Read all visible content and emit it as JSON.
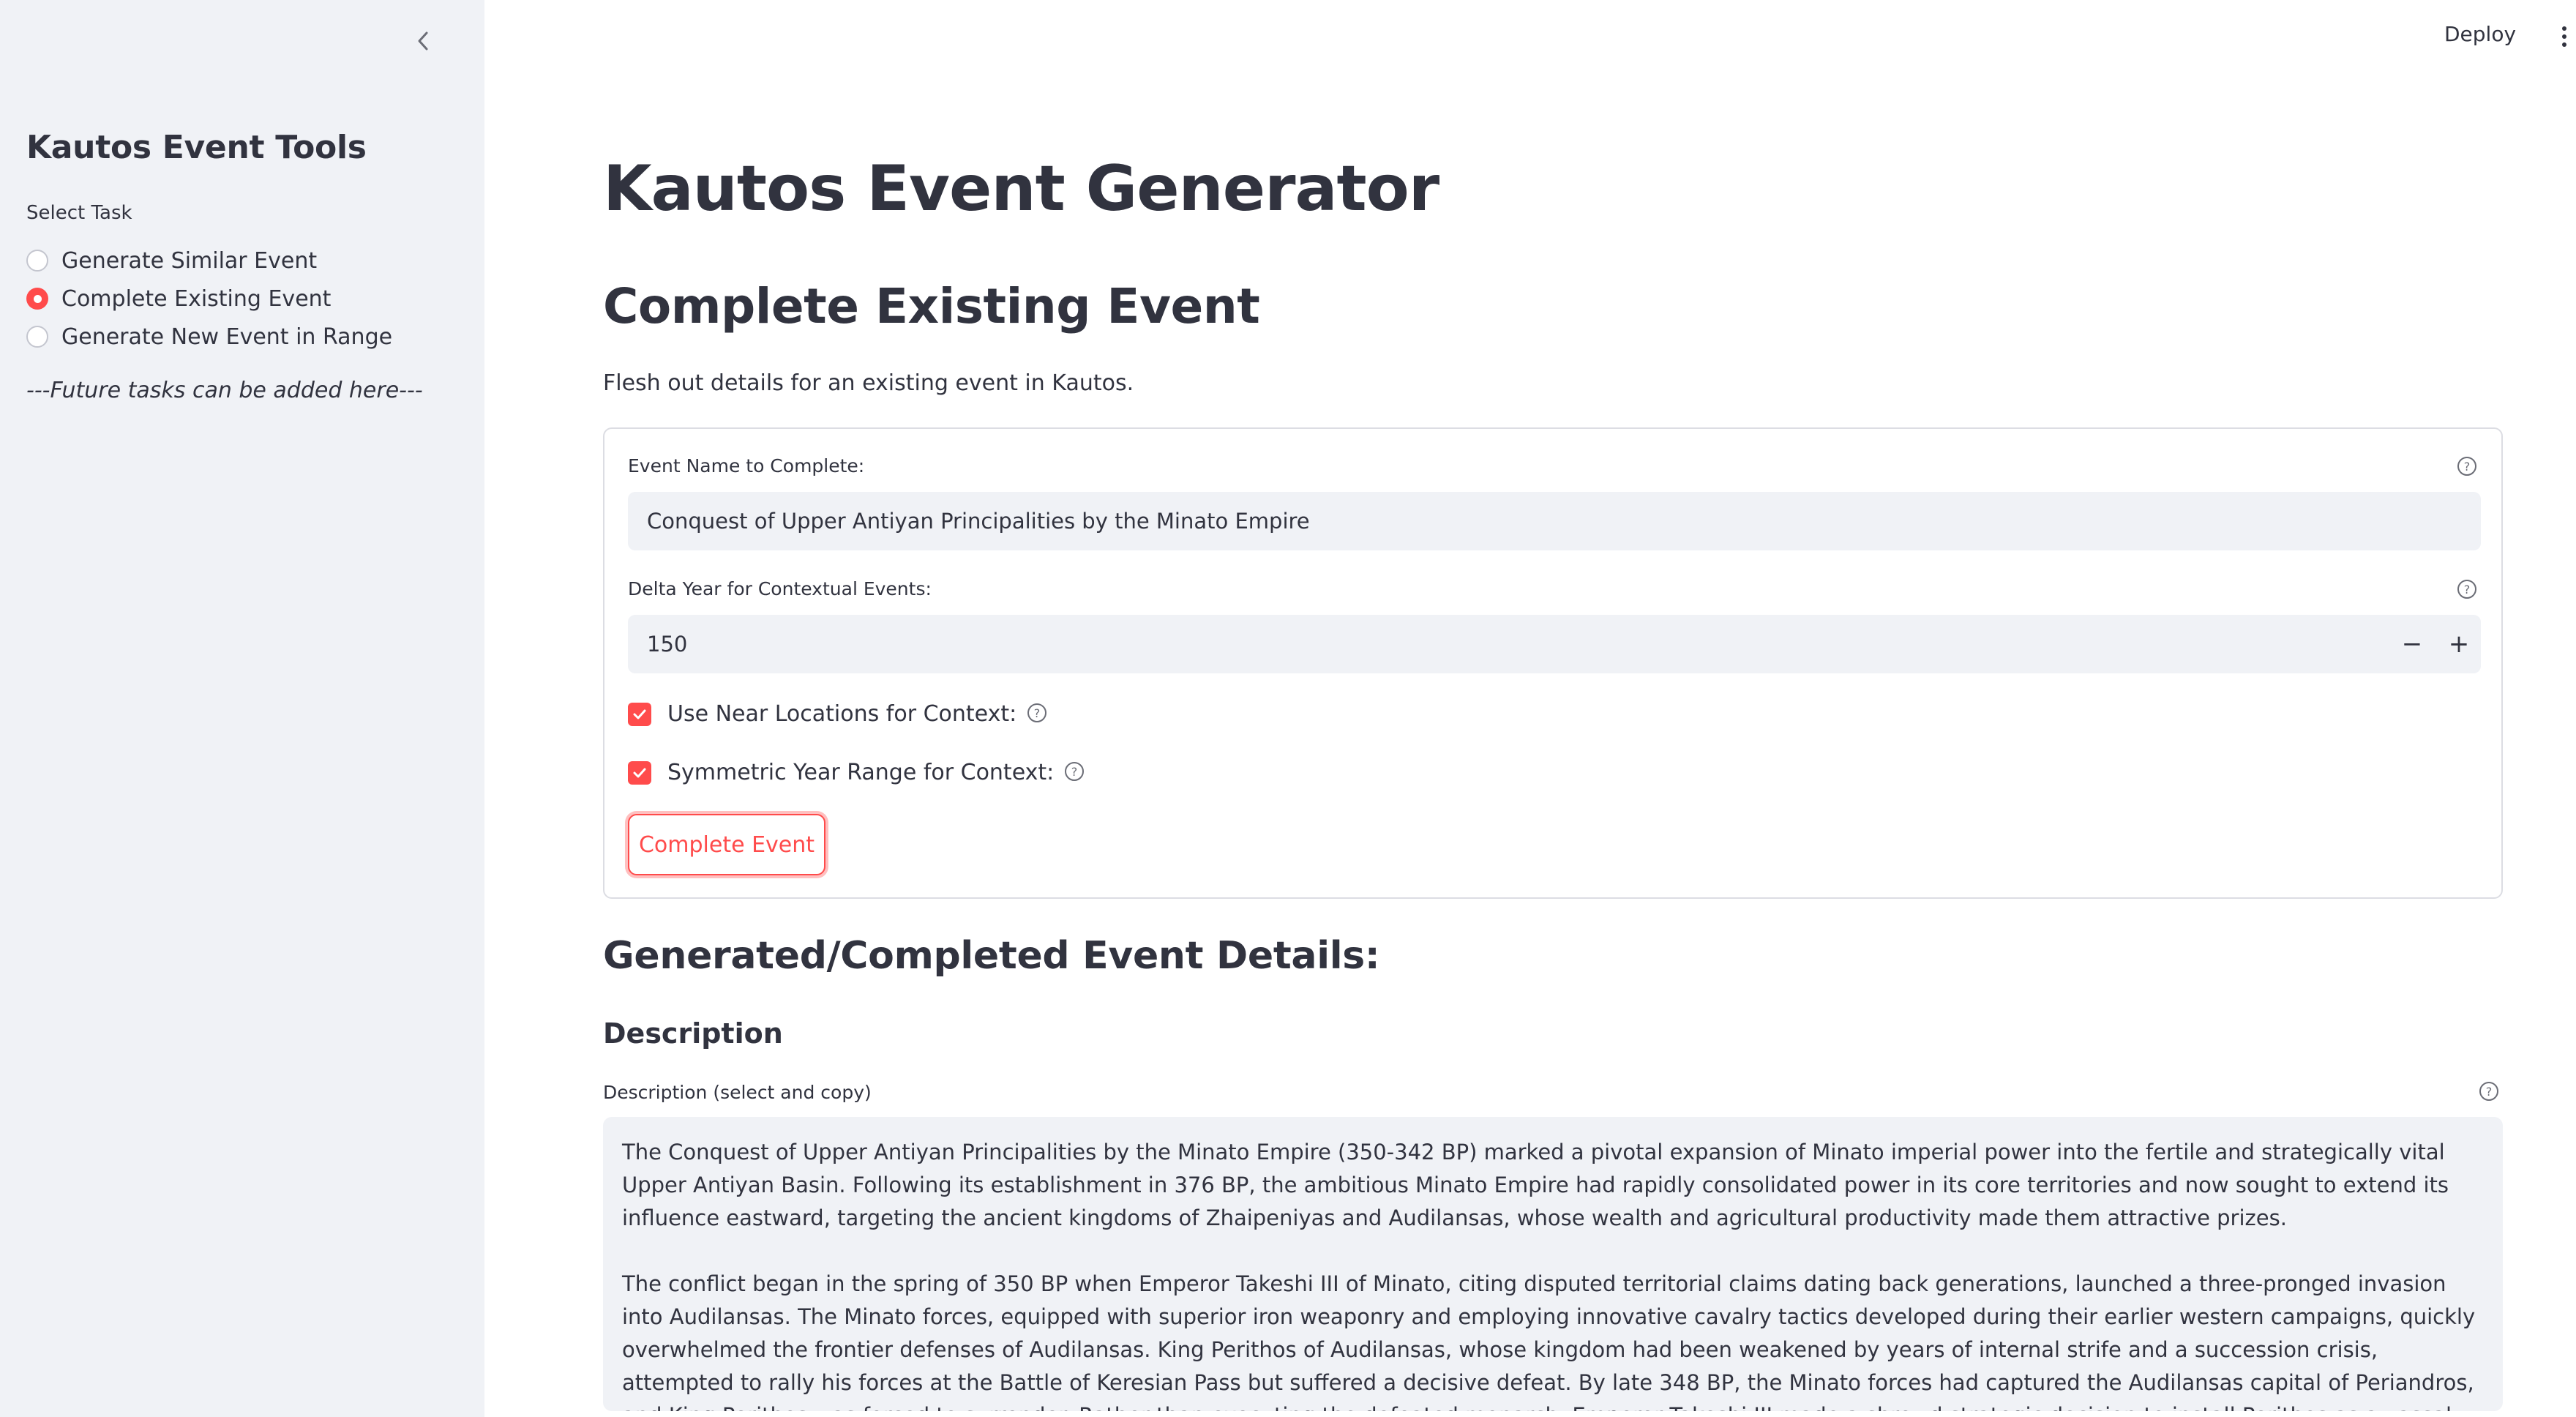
{
  "sidebar": {
    "title": "Kautos Event Tools",
    "select_label": "Select Task",
    "options": [
      {
        "label": "Generate Similar Event",
        "selected": false
      },
      {
        "label": "Complete Existing Event",
        "selected": true
      },
      {
        "label": "Generate New Event in Range",
        "selected": false
      }
    ],
    "note": "---Future tasks can be added here---"
  },
  "header": {
    "deploy_label": "Deploy"
  },
  "main": {
    "title": "Kautos Event Generator",
    "section_title": "Complete Existing Event",
    "section_desc": "Flesh out details for an existing event in Kautos.",
    "form": {
      "event_name_label": "Event Name to Complete:",
      "event_name_value": "Conquest of Upper Antiyan Principalities by the Minato Empire",
      "delta_year_label": "Delta Year for Contextual Events:",
      "delta_year_value": "150",
      "minus_label": "−",
      "plus_label": "+",
      "near_locations_label": "Use Near Locations for Context:",
      "near_locations_checked": true,
      "symmetric_label": "Symmetric Year Range for Context:",
      "symmetric_checked": true,
      "submit_label": "Complete Event"
    },
    "results_title": "Generated/Completed Event Details:",
    "description_heading": "Description",
    "description_label": "Description (select and copy)",
    "description_paragraphs": [
      "The Conquest of Upper Antiyan Principalities by the Minato Empire (350-342 BP) marked a pivotal expansion of Minato imperial power into the fertile and strategically vital Upper Antiyan Basin. Following its establishment in 376 BP, the ambitious Minato Empire had rapidly consolidated power in its core territories and now sought to extend its influence eastward, targeting the ancient kingdoms of Zhaipeniyas and Audilansas, whose wealth and agricultural productivity made them attractive prizes.",
      "The conflict began in the spring of 350 BP when Emperor Takeshi III of Minato, citing disputed territorial claims dating back generations, launched a three-pronged invasion into Audilansas. The Minato forces, equipped with superior iron weaponry and employing innovative cavalry tactics developed during their earlier western campaigns, quickly overwhelmed the frontier defenses of Audilansas. King Perithos of Audilansas, whose kingdom had been weakened by years of internal strife and a succession crisis, attempted to rally his forces at the Battle of Keresian Pass but suffered a decisive defeat. By late 348 BP, the Minato forces had captured the Audilansas capital of Periandros, and King Perithos was forced to surrender. Rather than executing the defeated monarch, Emperor Takeshi III made a shrewd strategic decision to install Perithos as a vassal ruler, preserving the kingdom's administrative structures while securing its tribute and loyalty."
    ]
  }
}
